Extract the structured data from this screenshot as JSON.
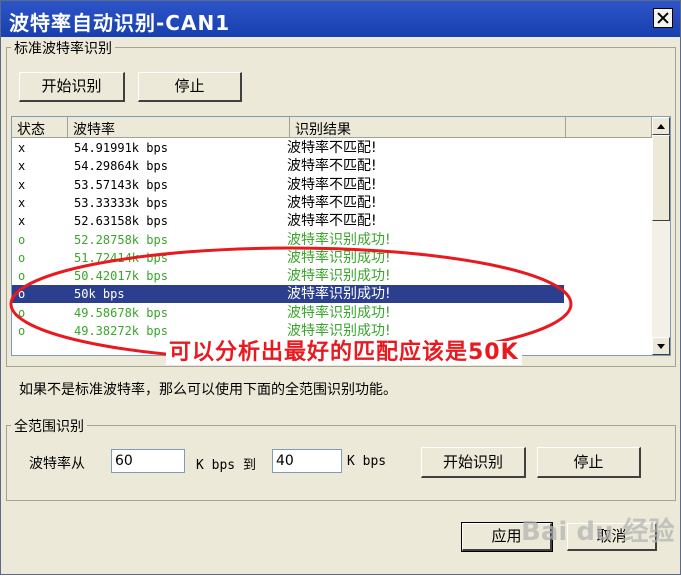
{
  "window": {
    "title": "波特率自动识别-CAN1"
  },
  "standard_group": {
    "label": "标准波特率识别",
    "start_label": "开始识别",
    "stop_label": "停止",
    "columns": [
      "状态",
      "波特率",
      "识别结果"
    ],
    "rows": [
      {
        "status": "x",
        "rate": "54.91991k bps",
        "result": "波特率不匹配!",
        "state": "fail"
      },
      {
        "status": "x",
        "rate": "54.29864k bps",
        "result": "波特率不匹配!",
        "state": "fail"
      },
      {
        "status": "x",
        "rate": "53.57143k bps",
        "result": "波特率不匹配!",
        "state": "fail"
      },
      {
        "status": "x",
        "rate": "53.33333k bps",
        "result": "波特率不匹配!",
        "state": "fail"
      },
      {
        "status": "x",
        "rate": "52.63158k bps",
        "result": "波特率不匹配!",
        "state": "fail"
      },
      {
        "status": "o",
        "rate": "52.28758k bps",
        "result": "波特率识别成功!",
        "state": "ok"
      },
      {
        "status": "o",
        "rate": "51.72414k bps",
        "result": "波特率识别成功!",
        "state": "ok"
      },
      {
        "status": "o",
        "rate": "50.42017k bps",
        "result": "波特率识别成功!",
        "state": "ok"
      },
      {
        "status": "o",
        "rate": "50k bps",
        "result": "波特率识别成功!",
        "state": "selected"
      },
      {
        "status": "o",
        "rate": "49.58678k bps",
        "result": "波特率识别成功!",
        "state": "ok"
      },
      {
        "status": "o",
        "rate": "49.38272k bps",
        "result": "波特率识别成功!",
        "state": "ok"
      }
    ]
  },
  "annotation": "可以分析出最好的匹配应该是50K",
  "hint": "如果不是标准波特率，那么可以使用下面的全范围识别功能。",
  "full_range_group": {
    "label": "全范围识别",
    "from_label": "波特率从",
    "from_value": "60",
    "unit_to_label": "K bps 到",
    "to_value": "40",
    "unit_label": "K bps",
    "start_label": "开始识别",
    "stop_label": "停止"
  },
  "footer": {
    "apply_label": "应用",
    "cancel_label": "取消"
  },
  "watermark": "Bai du 经验",
  "colors": {
    "success_text": "#3aa52b",
    "selection": "#2b3f8e",
    "annotation": "#e8191f",
    "titlebar": "#2048bf"
  }
}
